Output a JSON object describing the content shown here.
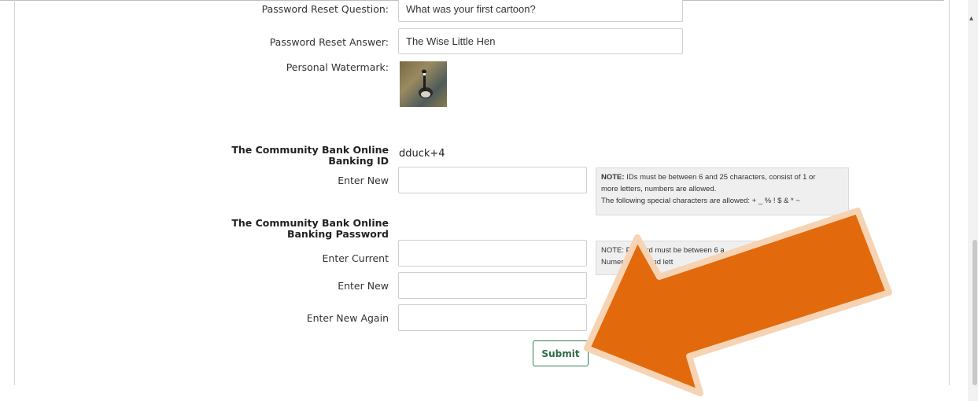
{
  "form": {
    "reset_question_label": "Password Reset Question:",
    "reset_question_value": "What was your first cartoon?",
    "reset_answer_label": "Password Reset Answer:",
    "reset_answer_value": "The Wise Little Hen",
    "watermark_label": "Personal Watermark:",
    "banking_id_label_line1": "The Community Bank Online",
    "banking_id_label_line2": "Banking ID",
    "banking_id_value": "dduck+4",
    "id_enter_new_label": "Enter New",
    "id_enter_new_value": "",
    "id_note_bold": "NOTE:",
    "id_note_line1": " IDs must be between 6 and 25 characters, consist of 1 or",
    "id_note_line2": "more letters, numbers are allowed.",
    "id_note_line3": "The following special characters are allowed: + _ % ! $ & * ~",
    "password_label_line1": "The Community Bank Online",
    "password_label_line2": "Banking Password",
    "pw_current_label": "Enter Current",
    "pw_current_value": "",
    "pw_new_label": "Enter New",
    "pw_new_value": "",
    "pw_new_again_label": "Enter New Again",
    "pw_new_again_value": "",
    "pw_note_line1": "NOTE: P   sword must be between 6 a",
    "pw_note_line2": "Numer    mbers and lett",
    "submit_label": "Submit"
  },
  "annotation": {
    "arrow_color": "#e26a0d",
    "arrow_outline": "#f6d3b3"
  }
}
